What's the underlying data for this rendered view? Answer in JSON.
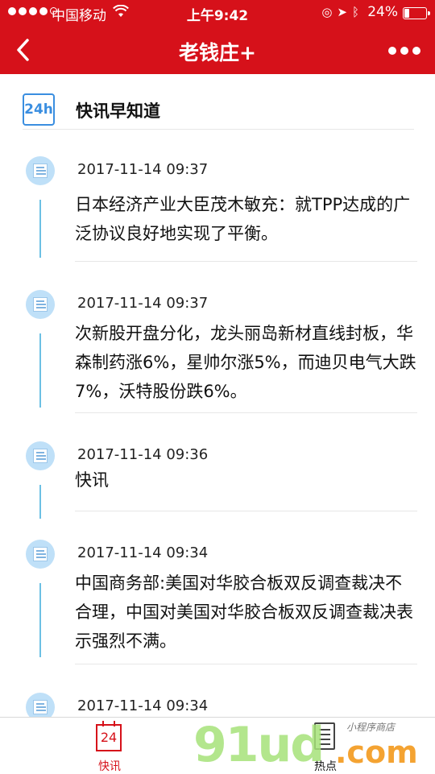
{
  "status_bar": {
    "carrier": "中国移动",
    "time": "上午9:42",
    "battery": "24%",
    "battery_level": 0.24,
    "signal_bars_filled": 4,
    "signal_bars_total": 5
  },
  "nav": {
    "title": "老钱庄+",
    "back_icon": "chevron-left-icon",
    "more_icon": "more-dots-icon"
  },
  "section": {
    "badge": "24h",
    "title": "快讯早知道"
  },
  "news": [
    {
      "time": "2017-11-14 09:37",
      "text": "日本经济产业大臣茂木敏充：就TPP达成的广泛协议良好地实现了平衡。"
    },
    {
      "time": "2017-11-14 09:37",
      "text": "次新股开盘分化，龙头丽岛新材直线封板，华森制药涨6%，星帅尔涨5%，而迪贝电气大跌7%，沃特股份跌6%。"
    },
    {
      "time": "2017-11-14 09:36",
      "text": "快讯"
    },
    {
      "time": "2017-11-14 09:34",
      "text": "中国商务部:美国对华胶合板双反调查裁决不合理，中国对美国对华胶合板双反调查裁决表示强烈不满。"
    },
    {
      "time": "2017-11-14 09:34",
      "text": ""
    }
  ],
  "tabbar": {
    "tab1_icon_text": "24",
    "tab1_label": "快讯",
    "tab2_label": "热点"
  },
  "watermark": {
    "brand": "91ud",
    "domain": ".com",
    "tagline": "小程序商店"
  },
  "colors": {
    "brand_red": "#d6111a",
    "timeline_blue": "#6cc0e4",
    "badge_blue": "#3a8ee0"
  }
}
